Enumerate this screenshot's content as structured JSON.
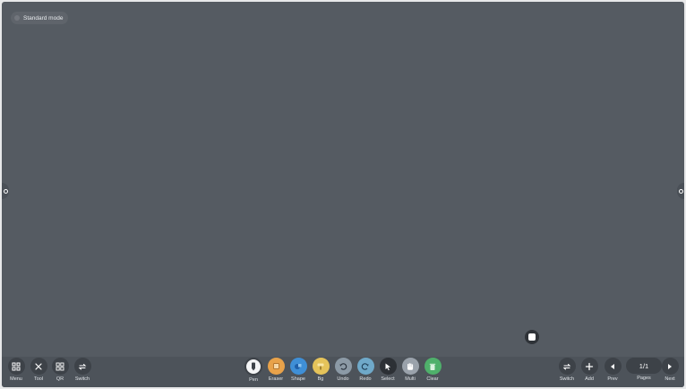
{
  "mode_badge": {
    "label": "Standard mode"
  },
  "left_toolbar": [
    {
      "label": "Menu",
      "icon": "grid-icon"
    },
    {
      "label": "Tool",
      "icon": "tools-icon"
    },
    {
      "label": "QR",
      "icon": "qr-icon"
    },
    {
      "label": "Switch",
      "icon": "switch-icon"
    }
  ],
  "center_toolbar": [
    {
      "label": "Pen",
      "icon": "pen-icon",
      "active": true
    },
    {
      "label": "Eraser",
      "icon": "eraser-icon"
    },
    {
      "label": "Shape",
      "icon": "shape-icon"
    },
    {
      "label": "Bg",
      "icon": "background-icon"
    },
    {
      "label": "Undo",
      "icon": "undo-icon"
    },
    {
      "label": "Redo",
      "icon": "redo-icon"
    },
    {
      "label": "Select",
      "icon": "cursor-icon"
    },
    {
      "label": "Multi",
      "icon": "hand-icon"
    },
    {
      "label": "Clear",
      "icon": "trash-icon"
    }
  ],
  "right_toolbar": {
    "switch_label": "Switch",
    "add_label": "Add",
    "prev_label": "Prev",
    "pages_label": "Pages",
    "pages_value": "1/1",
    "next_label": "Next"
  },
  "colors": {
    "canvas": "#555b62",
    "toolbar": "#4d535a"
  }
}
